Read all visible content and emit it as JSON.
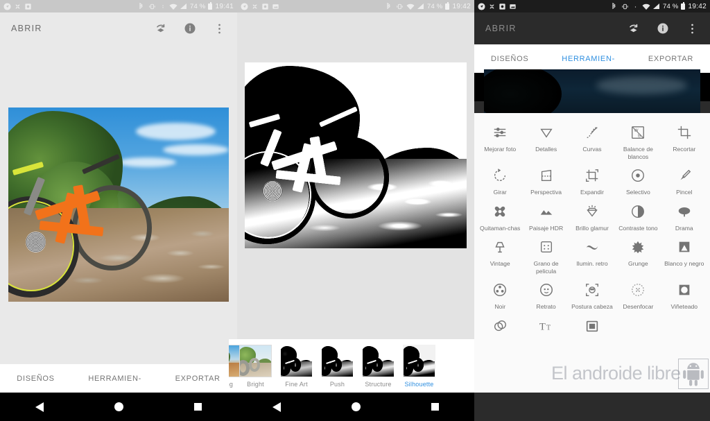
{
  "screens": [
    {
      "id": "open-screen",
      "theme": "light",
      "statusbar": {
        "left_icons": [
          "navigation-icon",
          "shuffle-icon",
          "screenshot-icon"
        ],
        "right_icons": [
          "bluetooth-icon",
          "vibrate-icon",
          "dot-icon",
          "wifi-icon",
          "signal-icon"
        ],
        "battery": "74 %",
        "clock": "19:41"
      },
      "toolbar": {
        "title": "ABRIR",
        "actions": [
          "undo-layers-icon",
          "info-icon",
          "overflow-menu-icon"
        ]
      },
      "photo_alt": "mountain bike on rocky trail, colour",
      "bottom_nav": [
        {
          "label": "DISEÑOS",
          "active": false
        },
        {
          "label": "HERRAMIEN-",
          "active": false
        },
        {
          "label": "EXPORTAR",
          "active": false
        }
      ]
    },
    {
      "id": "filter-screen",
      "theme": "light",
      "statusbar": {
        "left_icons": [
          "navigation-icon",
          "shuffle-icon",
          "screenshot-icon",
          "image-icon"
        ],
        "right_icons": [
          "bluetooth-icon",
          "vibrate-icon",
          "wifi-icon",
          "signal-icon"
        ],
        "battery": "74 %",
        "clock": "19:42"
      },
      "photo_alt": "mountain bike on rocky trail, high contrast black and white",
      "filmstrip": [
        {
          "label": "orning",
          "style": "morning",
          "selected": false,
          "clipped": true
        },
        {
          "label": "Bright",
          "style": "bright",
          "selected": false,
          "clipped": false
        },
        {
          "label": "Fine Art",
          "style": "fineart",
          "selected": false,
          "clipped": false
        },
        {
          "label": "Push",
          "style": "push",
          "selected": false,
          "clipped": false
        },
        {
          "label": "Structure",
          "style": "structure",
          "selected": false,
          "clipped": false
        },
        {
          "label": "Silhouette",
          "style": "silhouette",
          "selected": true,
          "clipped": false
        }
      ],
      "bottom_actions": [
        "cancel-icon",
        "confirm-icon"
      ]
    },
    {
      "id": "tools-screen",
      "theme": "dark",
      "statusbar": {
        "left_icons": [
          "navigation-icon",
          "shuffle-icon",
          "screenshot-icon",
          "image-icon"
        ],
        "right_icons": [
          "bluetooth-icon",
          "vibrate-icon",
          "dot-icon",
          "wifi-icon",
          "signal-icon"
        ],
        "battery": "74 %",
        "clock": "19:42"
      },
      "toolbar": {
        "title": "ABRIR",
        "actions": [
          "undo-layers-icon",
          "info-icon",
          "overflow-menu-icon"
        ]
      },
      "tools": [
        {
          "label": "Mejorar foto",
          "icon": "sliders-icon"
        },
        {
          "label": "Detalles",
          "icon": "triangle-down-icon"
        },
        {
          "label": "Curvas",
          "icon": "curves-icon"
        },
        {
          "label": "Balance de blancos",
          "icon": "white-balance-icon"
        },
        {
          "label": "Recortar",
          "icon": "crop-icon"
        },
        {
          "label": "Girar",
          "icon": "rotate-icon"
        },
        {
          "label": "Perspectiva",
          "icon": "perspective-icon"
        },
        {
          "label": "Expandir",
          "icon": "expand-icon"
        },
        {
          "label": "Selectivo",
          "icon": "selective-icon"
        },
        {
          "label": "Pincel",
          "icon": "brush-icon"
        },
        {
          "label": "Quitaman-chas",
          "icon": "healing-icon"
        },
        {
          "label": "Paisaje HDR",
          "icon": "hdr-landscape-icon"
        },
        {
          "label": "Brillo glamur",
          "icon": "glamour-glow-icon"
        },
        {
          "label": "Contraste tono",
          "icon": "tonal-contrast-icon"
        },
        {
          "label": "Drama",
          "icon": "drama-cloud-icon"
        },
        {
          "label": "Vintage",
          "icon": "vintage-lamp-icon"
        },
        {
          "label": "Grano de pelicula",
          "icon": "film-grain-icon"
        },
        {
          "label": "Ilumin. retro",
          "icon": "retrolux-icon"
        },
        {
          "label": "Grunge",
          "icon": "grunge-icon"
        },
        {
          "label": "Blanco y negro",
          "icon": "black-white-icon"
        },
        {
          "label": "Noir",
          "icon": "noir-reel-icon"
        },
        {
          "label": "Retrato",
          "icon": "portrait-icon"
        },
        {
          "label": "Postura cabeza",
          "icon": "head-pose-icon"
        },
        {
          "label": "Desenfocar",
          "icon": "lens-blur-icon"
        },
        {
          "label": "Viñeteado",
          "icon": "vignette-icon"
        },
        {
          "label": "",
          "icon": "double-exposure-icon"
        },
        {
          "label": "",
          "icon": "text-icon"
        },
        {
          "label": "",
          "icon": "frames-icon"
        }
      ],
      "bottom_nav": [
        {
          "label": "DISEÑOS",
          "active": false
        },
        {
          "label": "HERRAMIEN-",
          "active": true
        },
        {
          "label": "EXPORTAR",
          "active": false
        }
      ]
    }
  ],
  "watermark": {
    "text": "El androide libre",
    "logo": "android-robot-icon"
  },
  "system_nav": [
    "back-triangle-icon",
    "home-circle-icon",
    "recents-square-icon"
  ],
  "colors": {
    "accent": "#2f8fe0",
    "dark_bg": "#2b2b2b",
    "light_bg": "#e9e9e9",
    "sheet_bg": "#fafafa"
  }
}
